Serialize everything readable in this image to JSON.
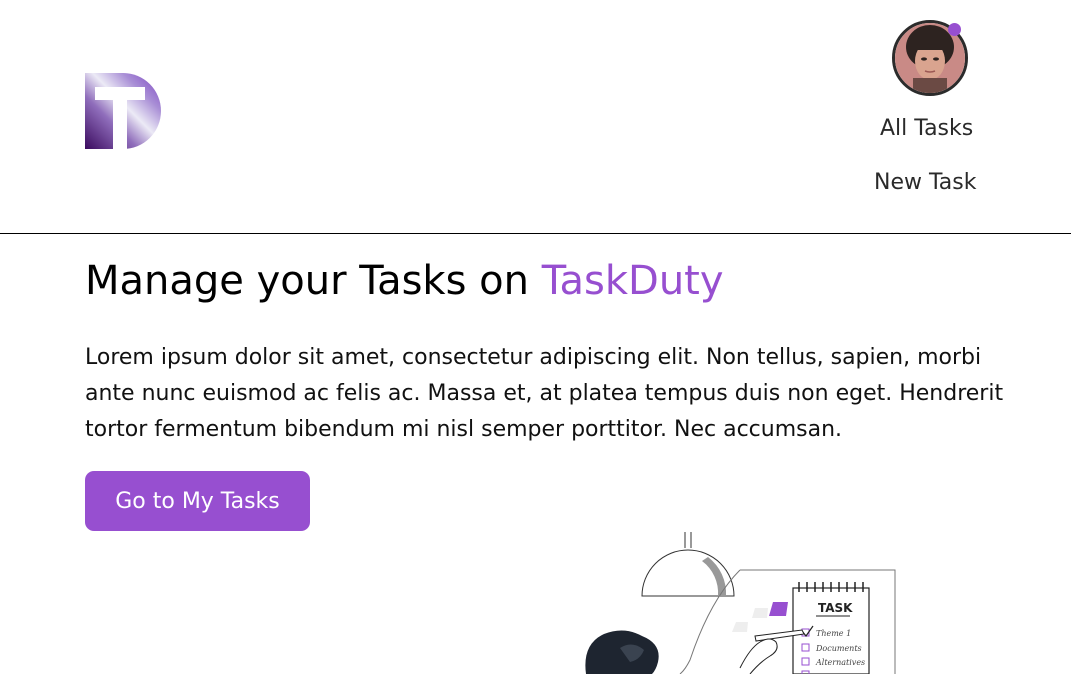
{
  "header": {
    "nav": {
      "all_tasks": "All Tasks",
      "new_task": "New Task"
    },
    "avatar_status_color": "#974FD0"
  },
  "hero": {
    "title_prefix": "Manage your Tasks on ",
    "title_brand": "TaskDuty",
    "description": "Lorem ipsum dolor sit amet, consectetur adipiscing elit. Non tellus, sapien, morbi ante nunc euismod ac felis ac. Massa et, at platea tempus duis non eget. Hendrerit tortor fermentum bibendum mi nisl semper porttitor. Nec accumsan.",
    "cta_label": "Go to My Tasks"
  },
  "illustration": {
    "note_title": "TASK",
    "items": [
      "Theme 1",
      "Documents",
      "Alternatives",
      ""
    ]
  },
  "colors": {
    "accent": "#974FD0",
    "text": "#000000",
    "divider": "#000000"
  }
}
